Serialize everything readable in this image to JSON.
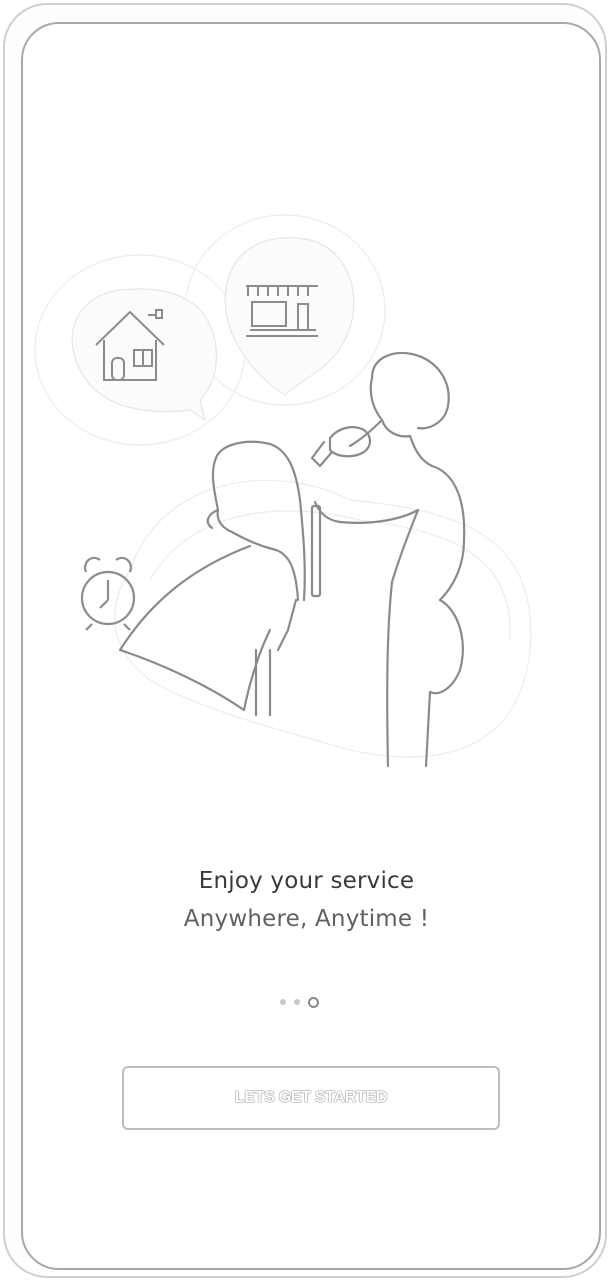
{
  "onboarding": {
    "headline": "Enjoy your service",
    "subline": "Anywhere, Anytime !",
    "pager": {
      "total": 3,
      "active_index": 2
    },
    "cta_label": "LETS GET STARTED"
  },
  "icons": {
    "illustration": "barber-service-illustration",
    "home": "home-icon",
    "shop": "shop-icon",
    "clock": "alarm-clock-icon"
  },
  "colors": {
    "frame": "#a8a8a8",
    "text_primary": "#3a3a3a",
    "text_secondary": "#606060",
    "dot_inactive": "#c8c8c8",
    "dot_active_border": "#8a8a8a"
  }
}
